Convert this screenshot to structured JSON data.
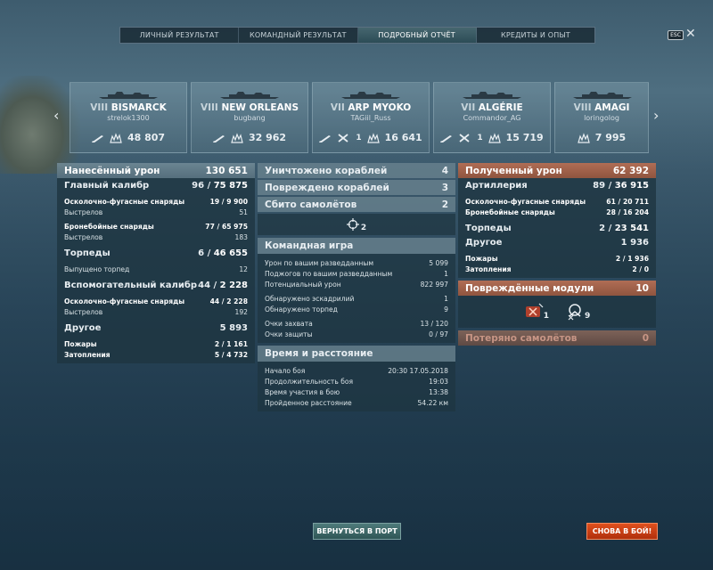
{
  "tabs": [
    {
      "label": "ЛИЧНЫЙ РЕЗУЛЬТАТ"
    },
    {
      "label": "КОМАНДНЫЙ РЕЗУЛЬТАТ"
    },
    {
      "label": "ПОДРОБНЫЙ ОТЧЁТ"
    },
    {
      "label": "КРЕДИТЫ И ОПЫТ"
    }
  ],
  "esc_label": "ESC",
  "close_glyph": "✕",
  "ships": [
    {
      "tier": "VIII",
      "name": "BISMARCK",
      "player": "strelok1300",
      "damage": "48 807",
      "kills": ""
    },
    {
      "tier": "VIII",
      "name": "NEW ORLEANS",
      "player": "bugbang",
      "damage": "32 962",
      "kills": ""
    },
    {
      "tier": "VII",
      "name": "ARP MYOKO",
      "player": "TAGiil_Russ",
      "damage": "16 641",
      "kills": "1"
    },
    {
      "tier": "VII",
      "name": "ALGÉRIE",
      "player": "Commandor_AG",
      "damage": "15 719",
      "kills": "1"
    },
    {
      "tier": "VIII",
      "name": "AMAGI",
      "player": "loringolog",
      "damage": "7 995",
      "kills": ""
    }
  ],
  "left": {
    "title": "Нанесённый урон",
    "total": "130 651",
    "main": {
      "label": "Главный калибр",
      "hits": "96",
      "dmg": "75 875",
      "he": {
        "label": "Осколочно-фугасные снаряды",
        "hits": "19",
        "dmg": "9 900"
      },
      "he_shots": {
        "label": "Выстрелов",
        "val": "51"
      },
      "ap": {
        "label": "Бронебойные снаряды",
        "hits": "77",
        "dmg": "65 975"
      },
      "ap_shots": {
        "label": "Выстрелов",
        "val": "183"
      }
    },
    "torp": {
      "label": "Торпеды",
      "hits": "6",
      "dmg": "46 655",
      "launched": {
        "label": "Выпущено торпед",
        "val": "12"
      }
    },
    "sec": {
      "label": "Вспомогательный калибр",
      "hits": "44",
      "dmg": "2 228",
      "he": {
        "label": "Осколочно-фугасные снаряды",
        "hits": "44",
        "dmg": "2 228"
      },
      "shots": {
        "label": "Выстрелов",
        "val": "192"
      }
    },
    "other": {
      "label": "Другое",
      "dmg": "5 893",
      "fires": {
        "label": "Пожары",
        "hits": "2",
        "dmg": "1 161"
      },
      "flood": {
        "label": "Затопления",
        "hits": "5",
        "dmg": "4 732"
      }
    }
  },
  "mid": {
    "destroyed": {
      "label": "Уничтожено кораблей",
      "val": "4"
    },
    "damaged": {
      "label": "Повреждено кораблей",
      "val": "3"
    },
    "planes": {
      "label": "Сбито самолётов",
      "val": "2"
    },
    "spotted_count": "2",
    "team": {
      "title": "Командная игра",
      "rows": [
        {
          "label": "Урон по вашим разведданным",
          "val": "5 099"
        },
        {
          "label": "Поджогов по вашим разведданным",
          "val": "1"
        },
        {
          "label": "Потенциальный урон",
          "val": "822 997"
        },
        {
          "label": "Обнаружено эскадрилий",
          "val": "1"
        },
        {
          "label": "Обнаружено торпед",
          "val": "9"
        },
        {
          "label": "Очки захвата",
          "val": "13 / 120"
        },
        {
          "label": "Очки защиты",
          "val": "0 / 97"
        }
      ]
    },
    "time": {
      "title": "Время и расстояние",
      "rows": [
        {
          "label": "Начало боя",
          "val": "20:30  17.05.2018"
        },
        {
          "label": "Продолжительность боя",
          "val": "19:03"
        },
        {
          "label": "Время участия в бою",
          "val": "13:38"
        },
        {
          "label": "Пройденное расстояние",
          "val": "54.22 км"
        }
      ]
    }
  },
  "right": {
    "title": "Полученный урон",
    "total": "62 392",
    "art": {
      "label": "Артиллерия",
      "hits": "89",
      "dmg": "36 915",
      "he": {
        "label": "Осколочно-фугасные снаряды",
        "hits": "61",
        "dmg": "20 711"
      },
      "ap": {
        "label": "Бронебойные снаряды",
        "hits": "28",
        "dmg": "16 204"
      }
    },
    "torp": {
      "label": "Торпеды",
      "hits": "2",
      "dmg": "23 541"
    },
    "other": {
      "label": "Другое",
      "dmg": "1 936",
      "fires": {
        "label": "Пожары",
        "hits": "2",
        "dmg": "1 936"
      },
      "flood": {
        "label": "Затопления",
        "hits": "2",
        "dmg": "0"
      }
    },
    "modules": {
      "title": "Повреждённые модули",
      "val": "10",
      "engine": "1",
      "steering": "9"
    },
    "lost_planes": {
      "label": "Потеряно самолётов",
      "val": "0"
    }
  },
  "buttons": {
    "port": "ВЕРНУТЬСЯ В ПОРТ",
    "battle": "СНОВА В БОЙ!"
  },
  "colors": {
    "received_header": "#b06d55",
    "battle_button": "#e0501e",
    "port_button": "#4e7a7a"
  }
}
